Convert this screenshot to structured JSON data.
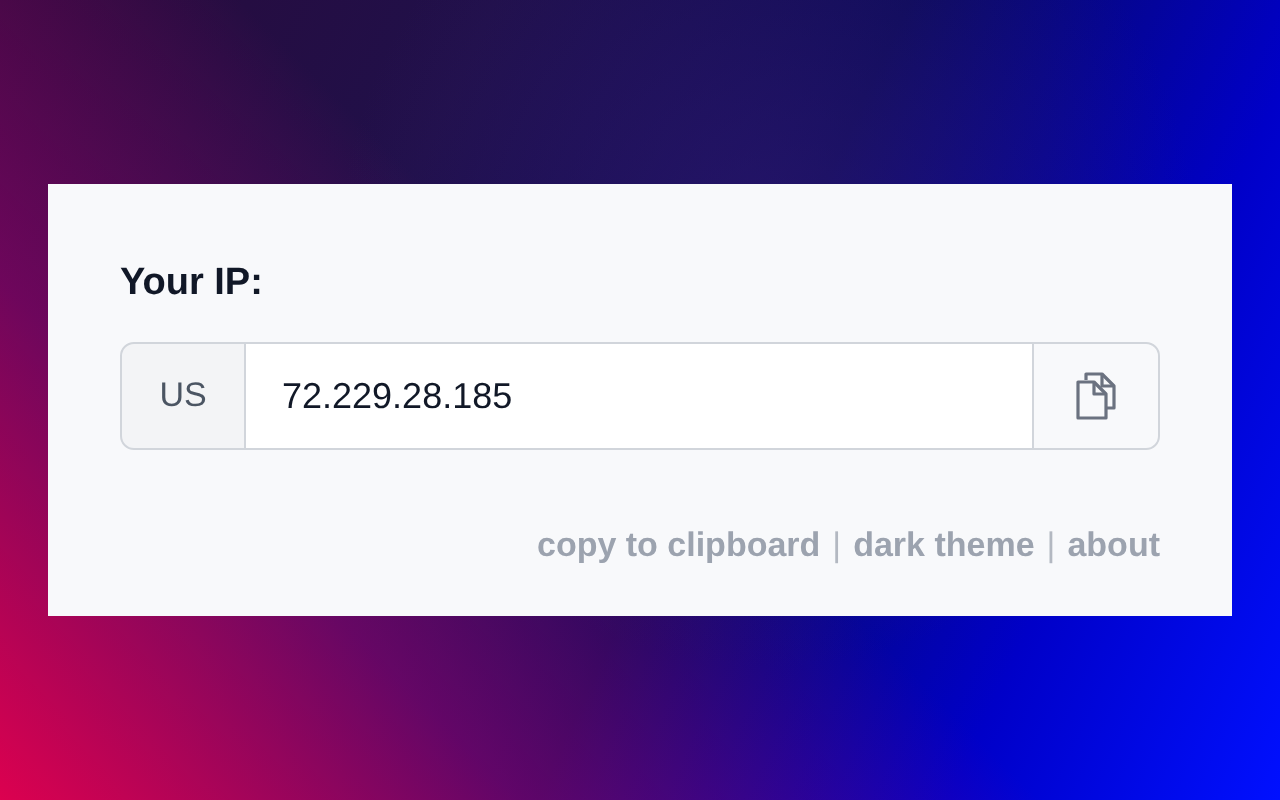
{
  "label": "Your IP:",
  "ip_field": {
    "country": "US",
    "value": "72.229.28.185"
  },
  "footer": [
    {
      "kind": "link",
      "text": "copy to clipboard"
    },
    {
      "kind": "separator",
      "text": "|"
    },
    {
      "kind": "link",
      "text": "dark theme"
    },
    {
      "kind": "separator",
      "text": "|"
    },
    {
      "kind": "link",
      "text": "about"
    }
  ]
}
